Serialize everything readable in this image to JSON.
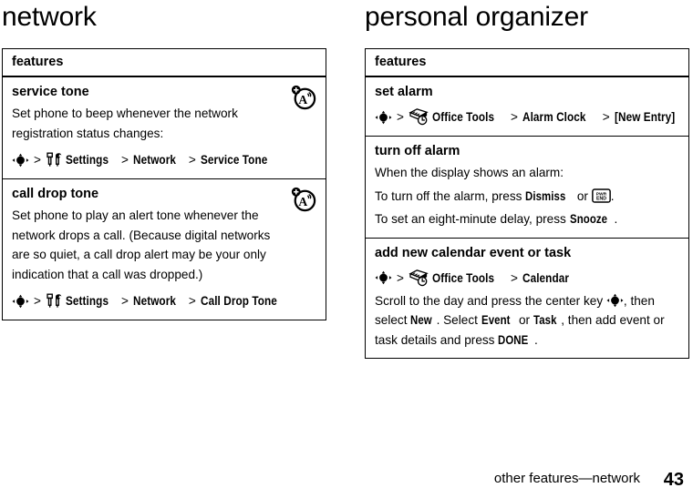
{
  "page": {
    "footer_text": "other features—network",
    "page_number": "43"
  },
  "columns": [
    {
      "title": "network",
      "table": {
        "header": "features",
        "rows": [
          {
            "name": "service tone",
            "icon": "alert-tone-icon",
            "paragraphs": [
              "Set phone to beep whenever the network registration status changes:"
            ],
            "path": {
              "start_icon": "nav-key-icon",
              "items": [
                {
                  "icon": "tools-icon",
                  "label": "Settings"
                },
                {
                  "icon": "",
                  "label": "Network"
                },
                {
                  "icon": "",
                  "label": "Service Tone"
                }
              ]
            }
          },
          {
            "name": "call drop tone",
            "icon": "alert-tone-icon",
            "paragraphs": [
              "Set phone to play an alert tone whenever the network drops a call. (Because digital networks are so quiet, a call drop alert may be your only indication that a call was dropped.)"
            ],
            "path": {
              "start_icon": "nav-key-icon",
              "items": [
                {
                  "icon": "tools-icon",
                  "label": "Settings"
                },
                {
                  "icon": "",
                  "label": "Network"
                },
                {
                  "icon": "",
                  "label": "Call Drop Tone"
                }
              ]
            }
          }
        ]
      }
    },
    {
      "title": "personal organizer",
      "table": {
        "header": "features",
        "rows": [
          {
            "name": "set alarm",
            "icon": "",
            "paragraphs": [],
            "path": {
              "start_icon": "nav-key-icon",
              "items": [
                {
                  "icon": "office-tools-icon",
                  "label": "Office Tools"
                },
                {
                  "icon": "",
                  "label": "Alarm Clock"
                },
                {
                  "icon": "",
                  "label": "[New Entry]"
                }
              ]
            }
          },
          {
            "name": "turn off alarm",
            "icon": "",
            "paragraphs": [
              "When the display shows an alarm:"
            ],
            "rich_paragraphs": [
              {
                "parts": [
                  {
                    "t": "To turn off the alarm, press ",
                    "style": "normal"
                  },
                  {
                    "t": "Dismiss",
                    "style": "ui"
                  },
                  {
                    "t": " or ",
                    "style": "normal"
                  },
                  {
                    "t": "",
                    "style": "icon",
                    "icon": "pwr-end-key-icon"
                  },
                  {
                    "t": ".",
                    "style": "normal"
                  }
                ]
              },
              {
                "parts": [
                  {
                    "t": "To set an eight-minute delay, press ",
                    "style": "normal"
                  },
                  {
                    "t": "Snooze",
                    "style": "ui"
                  },
                  {
                    "t": ".",
                    "style": "normal"
                  }
                ]
              }
            ]
          },
          {
            "name": "add new calendar event or task",
            "icon": "",
            "path": {
              "start_icon": "nav-key-icon",
              "items": [
                {
                  "icon": "office-tools-icon",
                  "label": "Office Tools"
                },
                {
                  "icon": "",
                  "label": "Calendar"
                }
              ]
            },
            "rich_paragraphs": [
              {
                "parts": [
                  {
                    "t": "Scroll to the day and press the center key ",
                    "style": "normal"
                  },
                  {
                    "t": "",
                    "style": "icon",
                    "icon": "nav-key-icon"
                  },
                  {
                    "t": ", then select ",
                    "style": "normal"
                  },
                  {
                    "t": "New",
                    "style": "ui"
                  },
                  {
                    "t": ". Select ",
                    "style": "normal"
                  },
                  {
                    "t": "Event",
                    "style": "ui"
                  },
                  {
                    "t": " or ",
                    "style": "normal"
                  },
                  {
                    "t": "Task",
                    "style": "ui"
                  },
                  {
                    "t": ", then add event or task details and press ",
                    "style": "normal"
                  },
                  {
                    "t": "DONE",
                    "style": "ui"
                  },
                  {
                    "t": ".",
                    "style": "normal"
                  }
                ]
              }
            ]
          }
        ]
      }
    }
  ],
  "icons": {
    "nav_key": "nav-key-icon",
    "tools": "tools-icon",
    "office_tools": "office-tools-icon",
    "alert_tone": "alert-tone-icon",
    "pwr_end": "pwr-end-key-icon"
  },
  "colors": {
    "ink": "#000000",
    "paper": "#ffffff"
  }
}
